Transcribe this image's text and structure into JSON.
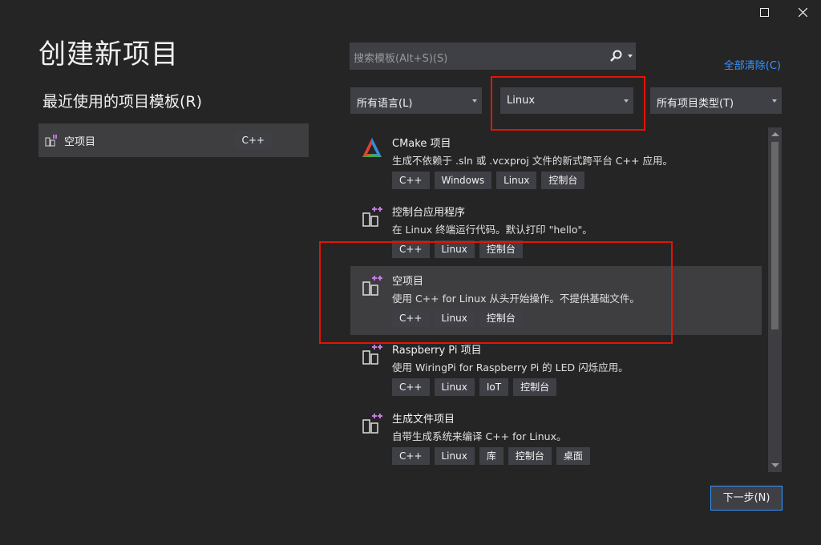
{
  "window": {
    "maximize_icon": "maximize-icon",
    "close_icon": "close-icon"
  },
  "title": "创建新项目",
  "recent": {
    "heading": "最近使用的项目模板(R)",
    "items": [
      {
        "name": "空项目",
        "tag": "C++"
      }
    ]
  },
  "search": {
    "placeholder": "搜索模板(Alt+S)(S)",
    "icon": "search-icon"
  },
  "clear_all": "全部清除(C)",
  "filters": {
    "language": "所有语言(L)",
    "platform": "Linux",
    "project_type": "所有项目类型(T)"
  },
  "templates": [
    {
      "name": "CMake 项目",
      "desc": "生成不依赖于 .sln 或 .vcxproj 文件的新式跨平台 C++ 应用。",
      "tags": [
        "C++",
        "Windows",
        "Linux",
        "控制台"
      ],
      "icon": "cmake-icon"
    },
    {
      "name": "控制台应用程序",
      "desc": "在 Linux 终端运行代码。默认打印 \"hello\"。",
      "tags": [
        "C++",
        "Linux",
        "控制台"
      ],
      "icon": "linux-project-icon"
    },
    {
      "name": "空项目",
      "desc": "使用 C++ for Linux 从头开始操作。不提供基础文件。",
      "tags": [
        "C++",
        "Linux",
        "控制台"
      ],
      "icon": "linux-project-icon",
      "selected": true
    },
    {
      "name": "Raspberry Pi 项目",
      "desc": "使用 WiringPi for Raspberry Pi 的 LED 闪烁应用。",
      "tags": [
        "C++",
        "Linux",
        "IoT",
        "控制台"
      ],
      "icon": "linux-project-icon"
    },
    {
      "name": "生成文件项目",
      "desc": "自带生成系统来编译 C++ for Linux。",
      "tags": [
        "C++",
        "Linux",
        "库",
        "控制台",
        "桌面"
      ],
      "icon": "linux-project-icon"
    }
  ],
  "next_button": "下一步(N)",
  "colors": {
    "background": "#252526",
    "accent": "#3794ff",
    "highlight": "#e51400"
  }
}
